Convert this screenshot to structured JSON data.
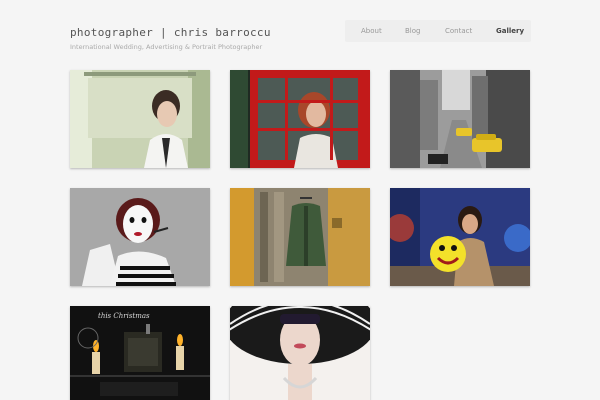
{
  "site": {
    "title": "photographer | chris barroccu",
    "tagline": "International Wedding, Advertising & Portrait Photographer"
  },
  "nav": {
    "items": [
      {
        "label": "About",
        "active": false
      },
      {
        "label": "Blog",
        "active": false
      },
      {
        "label": "Contact",
        "active": false
      },
      {
        "label": "Gallery",
        "active": true
      }
    ]
  },
  "gallery": {
    "photos": [
      {
        "name": "portrait-green-room"
      },
      {
        "name": "red-window-portrait"
      },
      {
        "name": "new-york-taxi-street"
      },
      {
        "name": "mime-portrait"
      },
      {
        "name": "green-jacket-door"
      },
      {
        "name": "woman-with-smiley-ball"
      },
      {
        "name": "christmas-candles",
        "caption": "this Christmas"
      },
      {
        "name": "woman-wide-hat"
      }
    ]
  }
}
